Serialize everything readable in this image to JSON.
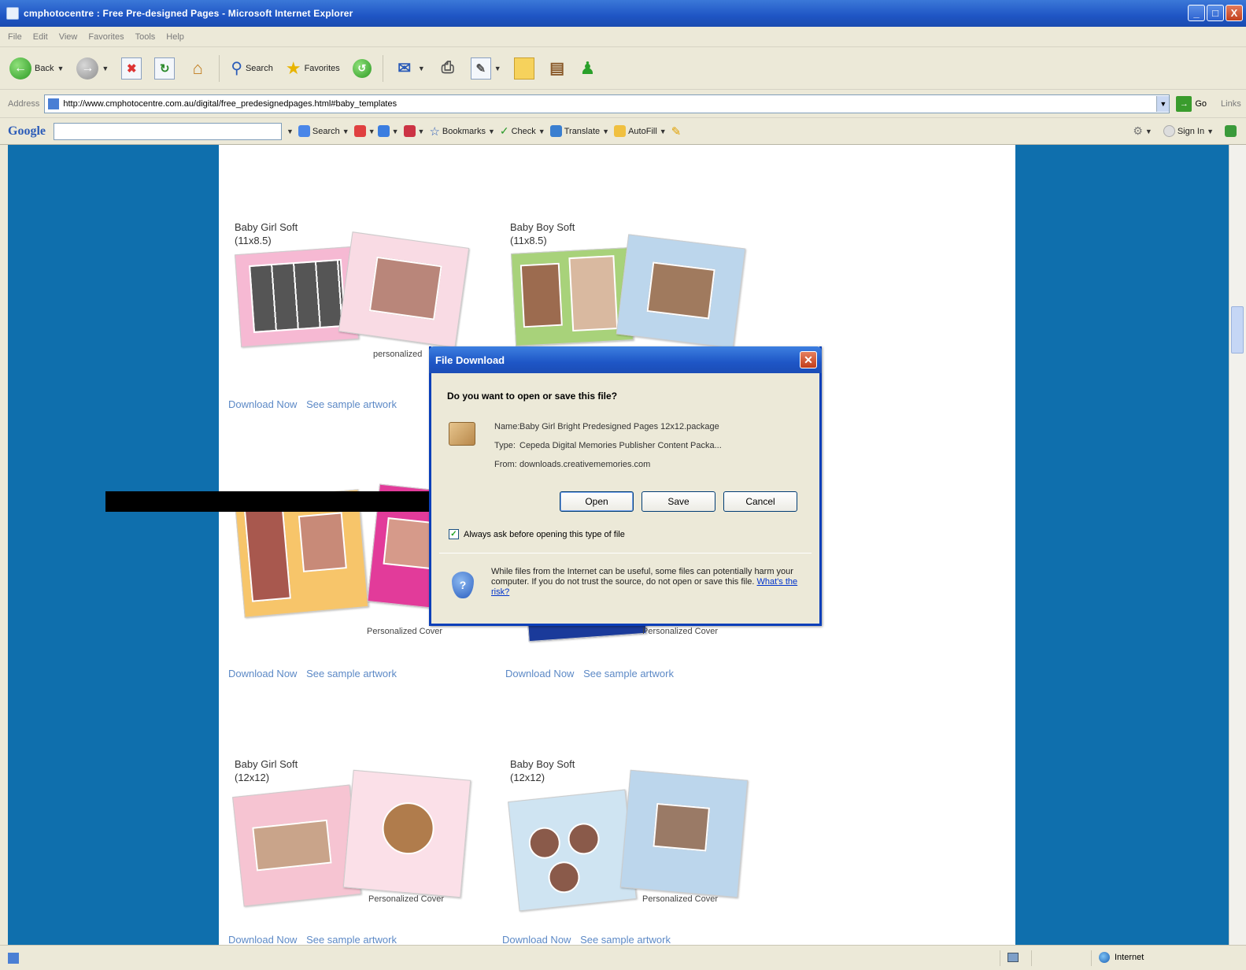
{
  "window": {
    "title": "cmphotocentre : Free Pre-designed Pages - Microsoft Internet Explorer",
    "minimize": "_",
    "maximize": "□",
    "close": "X"
  },
  "menu": [
    "File",
    "Edit",
    "View",
    "Favorites",
    "Tools",
    "Help"
  ],
  "toolbar": {
    "back": "Back",
    "search": "Search",
    "favorites": "Favorites"
  },
  "address": {
    "label": "Address",
    "url": "http://www.cmphotocentre.com.au/digital/free_predesignedpages.html#baby_templates",
    "go": "Go",
    "links": "Links"
  },
  "google_bar": {
    "logo": "Google",
    "search": "Search",
    "bookmarks": "Bookmarks",
    "check": "Check",
    "translate": "Translate",
    "autofill": "AutoFill",
    "sign_in": "Sign In"
  },
  "products": [
    {
      "title": "Baby Girl Soft",
      "size": "(11x8.5)",
      "cover": "personalized",
      "download": "Download Now",
      "sample": "See sample artwork"
    },
    {
      "title": "Baby Boy Soft",
      "size": "(11x8.5)",
      "cover": "",
      "download": "",
      "sample": ""
    },
    {
      "title": "",
      "size": "",
      "cover": "Personalized Cover",
      "download": "Download Now",
      "sample": "See sample artwork"
    },
    {
      "title": "",
      "size": "",
      "cover": "Personalized Cover",
      "download": "Download Now",
      "sample": "See sample artwork"
    },
    {
      "title": "Baby Girl Soft",
      "size": "(12x12)",
      "cover": "Personalized Cover",
      "download": "Download Now",
      "sample": "See sample artwork"
    },
    {
      "title": "Baby Boy Soft",
      "size": "(12x12)",
      "cover": "Personalized Cover",
      "download": "Download Now",
      "sample": "See sample artwork"
    }
  ],
  "dialog": {
    "title": "File Download",
    "question": "Do you want to open or save this file?",
    "name_label": "Name:",
    "name_value": "Baby Girl Bright Predesigned Pages 12x12.package",
    "type_label": "Type:",
    "type_value": "Cepeda Digital Memories Publisher Content Packa...",
    "from_label": "From:",
    "from_value": "downloads.creativememories.com",
    "open": "Open",
    "save": "Save",
    "cancel": "Cancel",
    "checkbox_label": "Always ask before opening this type of file",
    "checkbox_checked": true,
    "warning": "While files from the Internet can be useful, some files can potentially harm your computer. If you do not trust the source, do not open or save this file.",
    "risk_link": "What's the risk?"
  },
  "status": {
    "zone": "Internet"
  },
  "colors": {
    "background_blue": "#0f6fad",
    "link": "#5c89c6",
    "xp_title": "#1f55c4"
  }
}
